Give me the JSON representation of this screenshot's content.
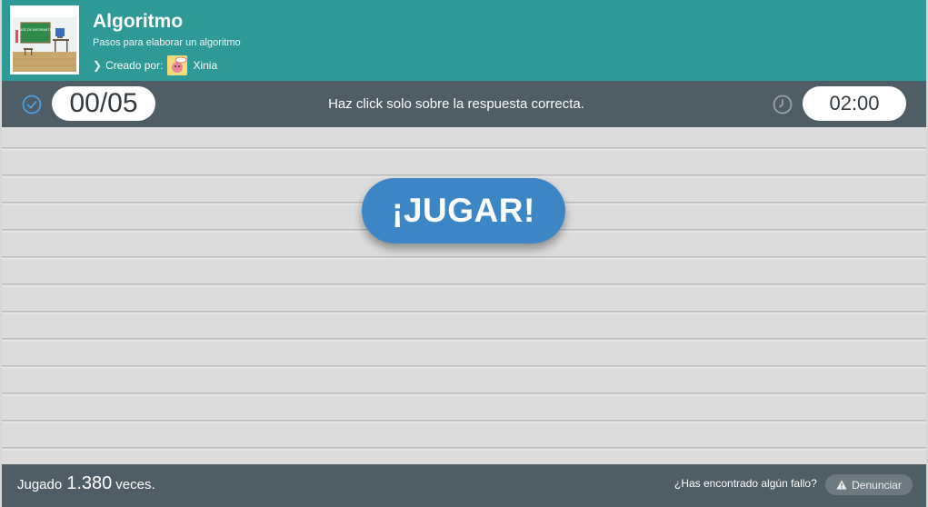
{
  "header": {
    "title": "Algoritmo",
    "subtitle": "Pasos para elaborar un algoritmo",
    "created_by_label": "Creado por:",
    "author": "Xinia",
    "thumbnail_board_text": "CLASE DE INFORMÁTICA"
  },
  "status": {
    "score": "00/05",
    "instruction": "Haz click solo sobre la respuesta correcta.",
    "timer": "02:00"
  },
  "main": {
    "play_label": "¡JUGAR!"
  },
  "footer": {
    "played_prefix": "Jugado",
    "played_count": "1.380",
    "played_suffix": "veces.",
    "bug_question": "¿Has encontrado algún fallo?",
    "report_label": "Denunciar"
  },
  "icons": {
    "score": "check-circle-icon",
    "timer": "clock-icon",
    "report": "warning-icon",
    "creator_prefix": "chevron-right-icon"
  },
  "colors": {
    "header": "#2e9a98",
    "bar": "#4f5d66",
    "play_button": "#3d86c6",
    "icon_accent": "#4aa3df"
  }
}
